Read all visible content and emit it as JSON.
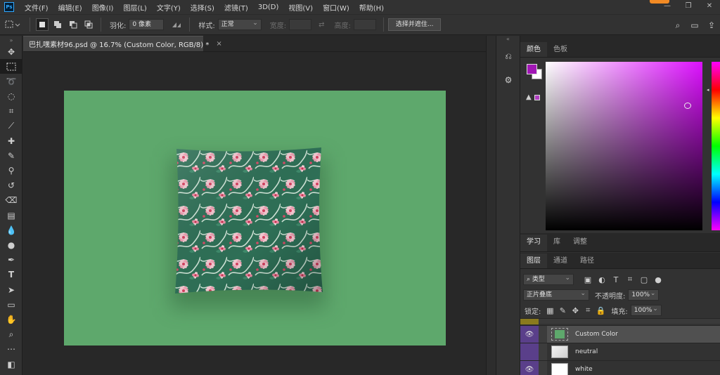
{
  "menu": {
    "app_icon": "Ps",
    "items": [
      "文件(F)",
      "编辑(E)",
      "图像(I)",
      "图层(L)",
      "文字(Y)",
      "选择(S)",
      "滤镜(T)",
      "3D(D)",
      "视图(V)",
      "窗口(W)",
      "帮助(H)"
    ]
  },
  "options": {
    "feather_label": "羽化:",
    "feather_value": "0 像素",
    "style_label": "样式:",
    "style_value": "正常",
    "width_label": "宽度:",
    "height_label": "高度:",
    "select_mask_button": "选择并遮住..."
  },
  "document": {
    "tab_title": "巴扎嘿素材96.psd @ 16.7% (Custom Color, RGB/8) *",
    "close_glyph": "×",
    "canvas_color": "#5ea86c"
  },
  "color_panel": {
    "tabs": [
      "颜色",
      "色板"
    ],
    "foreground": "#a117b5",
    "background": "#ffffff",
    "warning_glyph": "▲",
    "hue_arrow": "◂"
  },
  "learn_panel": {
    "tabs": [
      "学习",
      "库",
      "调整"
    ]
  },
  "layers_panel": {
    "tabs": [
      "图层",
      "通道",
      "路径"
    ],
    "filter_kind": "类型",
    "blend_mode": "正片叠底",
    "opacity_label": "不透明度:",
    "opacity_value": "100%",
    "lock_label": "锁定:",
    "fill_label": "填充:",
    "fill_value": "100%",
    "layers": [
      {
        "name": "Custom Color",
        "thumb": "#5ea86c",
        "selected": true
      },
      {
        "name": "neutral",
        "thumb": "#d8d8d8",
        "selected": false
      },
      {
        "name": "white",
        "thumb": "#ffffff",
        "selected": false
      }
    ]
  }
}
